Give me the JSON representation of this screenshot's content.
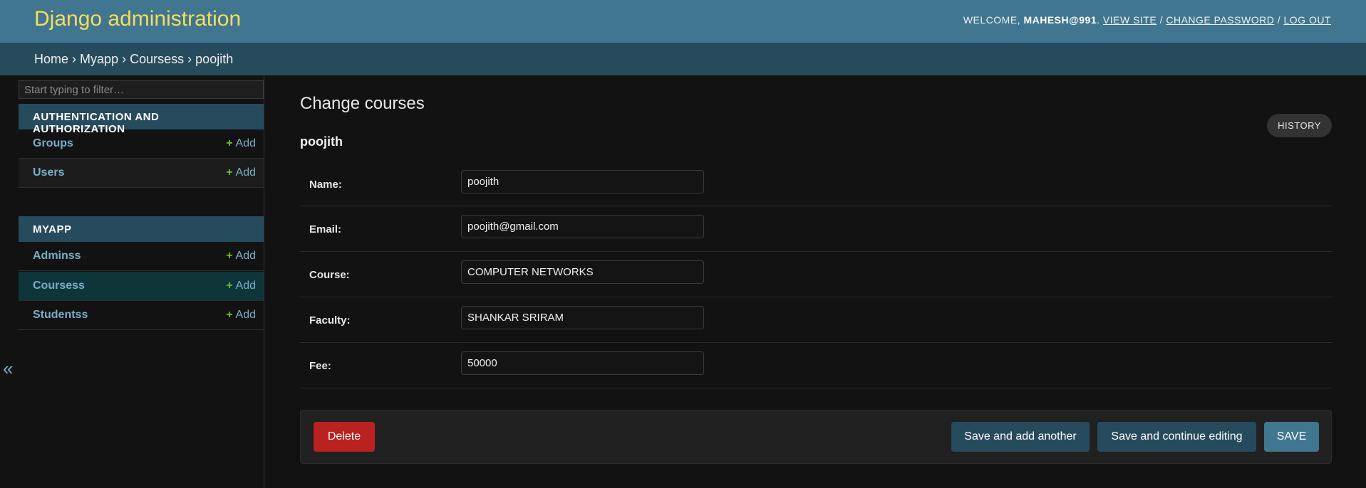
{
  "header": {
    "branding": "Django administration",
    "welcome": "Welcome,",
    "username": "mahesh@991",
    "view_site": "View site",
    "change_password": "Change password",
    "log_out": "Log out",
    "sep1": "/",
    "sep2": "/"
  },
  "breadcrumbs": {
    "home": "Home",
    "app": "Myapp",
    "model": "Coursess",
    "current": "poojith",
    "sep": "›"
  },
  "sidebar": {
    "collapse_icon": "«",
    "filter_placeholder": "Start typing to filter…",
    "modules": [
      {
        "caption": "Authentication and Authorization",
        "models": [
          {
            "name": "Groups",
            "add": "Add"
          },
          {
            "name": "Users",
            "add": "Add"
          }
        ]
      },
      {
        "caption": "Myapp",
        "models": [
          {
            "name": "Adminss",
            "add": "Add"
          },
          {
            "name": "Coursess",
            "add": "Add"
          },
          {
            "name": "Studentss",
            "add": "Add"
          }
        ]
      }
    ],
    "plus_icon": "+"
  },
  "main": {
    "title": "Change courses",
    "object_title": "poojith",
    "history": "History",
    "fields": [
      {
        "label": "Name:",
        "value": "poojith"
      },
      {
        "label": "Email:",
        "value": "poojith@gmail.com"
      },
      {
        "label": "Course:",
        "value": "COMPUTER NETWORKS"
      },
      {
        "label": "Faculty:",
        "value": "SHANKAR SRIRAM"
      },
      {
        "label": "Fee:",
        "value": "50000"
      }
    ],
    "buttons": {
      "delete": "Delete",
      "save_add_another": "Save and add another",
      "save_continue": "Save and continue editing",
      "save": "SAVE"
    }
  },
  "colors": {
    "header_bg": "#417690",
    "branding": "#f5dd5d",
    "breadcrumb_bg": "#264b5d",
    "link": "#79aec8",
    "add_plus": "#70bf2b",
    "delete": "#ba2121"
  }
}
